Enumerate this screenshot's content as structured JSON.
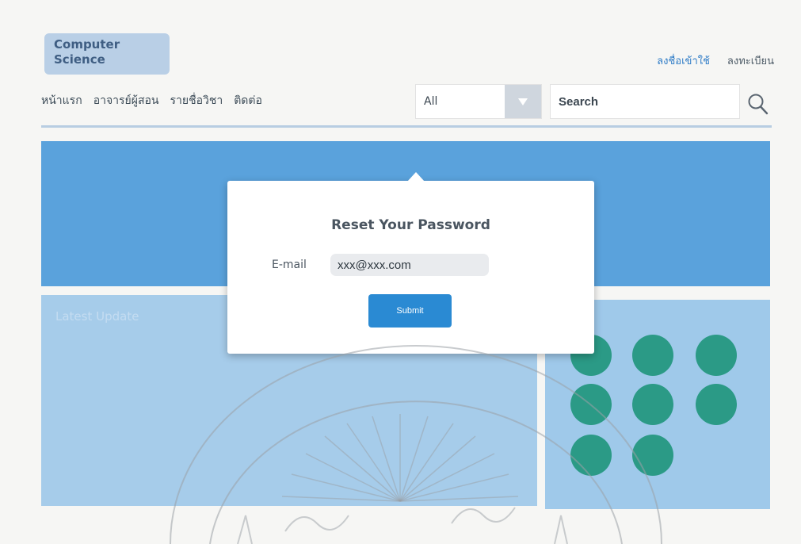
{
  "brand": {
    "line1": "Computer",
    "line2": "Science"
  },
  "top_links": {
    "login": "ลงชื่อเข้าใช้",
    "register": "ลงทะเบียน"
  },
  "nav": [
    {
      "label": "หน้าแรก"
    },
    {
      "label": "อาจารย์ผู้สอน"
    },
    {
      "label": "รายชื่อวิชา"
    },
    {
      "label": "ติดต่อ"
    }
  ],
  "filter": {
    "selected": "All"
  },
  "search": {
    "placeholder": "Search"
  },
  "latest": {
    "title": "Latest Update"
  },
  "modal": {
    "title": "Reset Your Password",
    "email_label": "E-mail",
    "email_value": "xxx@xxx.com",
    "submit_label": "Submit"
  },
  "colors": {
    "hero": "#5aa2dc",
    "panel": "#a6ccea",
    "dot": "#2b9a86",
    "button": "#2a8ad3",
    "link": "#2f7cc7"
  },
  "icons": {
    "dropdown": "chevron-down-icon",
    "search": "search-icon"
  }
}
